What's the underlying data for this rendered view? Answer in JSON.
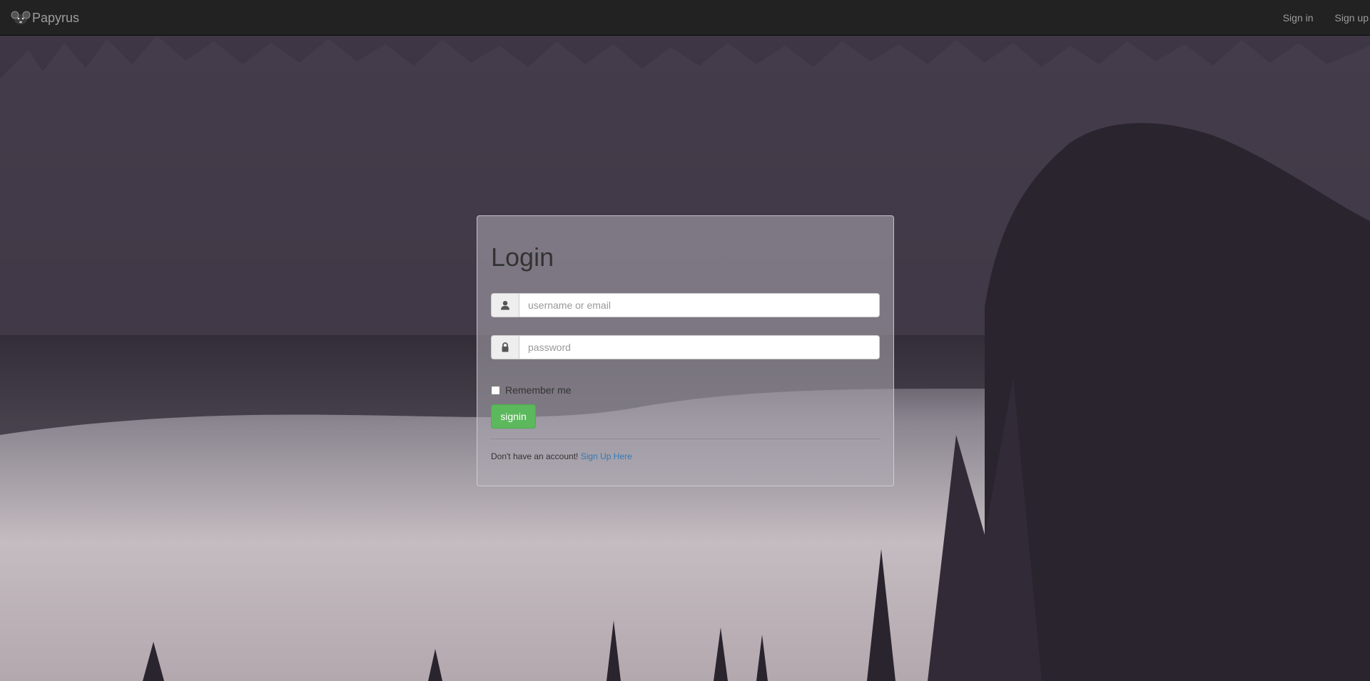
{
  "navbar": {
    "brand": "Papyrus",
    "brand_icon": "rat-logo-icon",
    "links": [
      "Sign in",
      "Sign up"
    ],
    "background": "#222222",
    "link_color": "#9d9d9d"
  },
  "login": {
    "title": "Login",
    "username": {
      "icon": "user-icon",
      "placeholder": "username or email",
      "value": ""
    },
    "password": {
      "icon": "lock-icon",
      "placeholder": "password",
      "value": ""
    },
    "remember_label": "Remember me",
    "remember_checked": false,
    "submit_label": "signin",
    "footer_text": "Don't have an account!",
    "footer_link": "Sign Up Here",
    "accent_color": "#5cb85c",
    "link_color": "#337ab7"
  },
  "background": {
    "description_icon": "forest-lake-background"
  }
}
